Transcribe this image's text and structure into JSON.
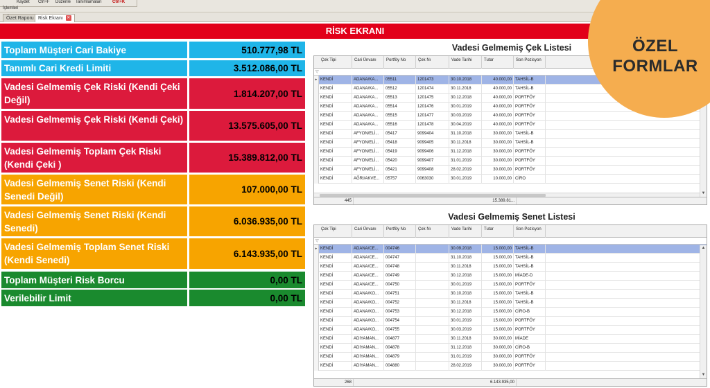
{
  "toolbar": {
    "items": [
      "Kaydet",
      "Ctrl+F",
      "Düzenle",
      "Tanımlamaları",
      "Ctrl+K"
    ],
    "group_label": "İşlemleri"
  },
  "tabs": [
    {
      "label": "Özet Raporu"
    },
    {
      "label": "Risk Ekranı"
    }
  ],
  "title": "RİSK EKRANI",
  "risk_items": [
    {
      "label": "Toplam Müşteri Cari Bakiye",
      "value": "510.777,98 TL",
      "color": "#1fb5e8"
    },
    {
      "label": "Tanımlı Cari Kredi Limiti",
      "value": "3.512.086,00 TL",
      "color": "#1fb5e8"
    },
    {
      "label": "Vadesi Gelmemiş Çek Riski (Kendi Çeki Değil)",
      "value": "1.814.207,00 TL",
      "color": "#dc1a3c"
    },
    {
      "label": "Vadesi Gelmemiş Çek Riski (Kendi Çeki)",
      "value": "13.575.605,00 TL",
      "color": "#dc1a3c"
    },
    {
      "label": "Vadesi Gelmemiş Toplam Çek Riski (Kendi Çeki )",
      "value": "15.389.812,00 TL",
      "color": "#dc1a3c"
    },
    {
      "label": "Vadesi Gelmemiş Senet Riski (Kendi Senedi Değil)",
      "value": "107.000,00 TL",
      "color": "#f7a400"
    },
    {
      "label": "Vadesi Gelmemiş Senet Riski (Kendi Senedi)",
      "value": "6.036.935,00 TL",
      "color": "#f7a400"
    },
    {
      "label": "Vadesi Gelmemiş Toplam Senet Riski (Kendi Senedi)",
      "value": "6.143.935,00 TL",
      "color": "#f7a400"
    },
    {
      "label": "Toplam Müşteri Risk Borcu",
      "value": "0,00 TL",
      "color": "#1a8a2e"
    },
    {
      "label": "Verilebilir Limit",
      "value": "0,00 TL",
      "color": "#1a8a2e"
    }
  ],
  "cek_grid": {
    "title": "Vadesi Gelmemiş Çek Listesi",
    "columns": [
      "Çek Tipi",
      "Cari Ünvanı",
      "Portföy No",
      "Çek Nı",
      "Vade Tarihi",
      "Tutar",
      "Son Pozisyon"
    ],
    "rows": [
      [
        "KENDİ",
        "ADANA/KA...",
        "05511",
        "1201473",
        "30.10.2018",
        "40.000,00",
        "TAHSİL-B"
      ],
      [
        "KENDİ",
        "ADANA/KA...",
        "05512",
        "1201474",
        "30.11.2018",
        "40.000,00",
        "TAHSİL-B"
      ],
      [
        "KENDİ",
        "ADANA/KA...",
        "05513",
        "1201475",
        "30.12.2018",
        "40.000,00",
        "PORTFÖY"
      ],
      [
        "KENDİ",
        "ADANA/KA...",
        "05514",
        "1201476",
        "30.01.2019",
        "40.000,00",
        "PORTFÖY"
      ],
      [
        "KENDİ",
        "ADANA/KA...",
        "05515",
        "1201477",
        "30.03.2019",
        "40.000,00",
        "PORTFÖY"
      ],
      [
        "KENDİ",
        "ADANA/KA...",
        "05516",
        "1201478",
        "30.04.2019",
        "40.000,00",
        "PORTFÖY"
      ],
      [
        "KENDİ",
        "AFYON/ELİ...",
        "05417",
        "9099404",
        "31.10.2018",
        "30.000,00",
        "TAHSİL-B"
      ],
      [
        "KENDİ",
        "AFYON/ELİ...",
        "05418",
        "9099405",
        "30.11.2018",
        "30.000,00",
        "TAHSİL-B"
      ],
      [
        "KENDİ",
        "AFYON/ELİ...",
        "05419",
        "9099406",
        "31.12.2018",
        "30.000,00",
        "PORTFÖY"
      ],
      [
        "KENDİ",
        "AFYON/ELİ...",
        "05420",
        "9099407",
        "31.01.2019",
        "30.000,00",
        "PORTFÖY"
      ],
      [
        "KENDİ",
        "AFYON/ELİ...",
        "05421",
        "9099408",
        "28.02.2019",
        "30.000,00",
        "PORTFÖY"
      ],
      [
        "KENDİ",
        "AĞRI/AKVE...",
        "05757",
        "0063030",
        "30.01.2019",
        "10.000,00",
        "CİRO"
      ]
    ],
    "footer_count": "445",
    "footer_total": "15.389.81..."
  },
  "senet_grid": {
    "title": "Vadesi Gelmemiş Senet Listesi",
    "columns": [
      "Çek Tipi",
      "Cari Ünvanı",
      "Portföy No",
      "Çek Nı",
      "Vade Tarihi",
      "Tutar",
      "Son Pozisyon"
    ],
    "rows": [
      [
        "KENDİ",
        "ADANA/CE...",
        "004746",
        "",
        "30.09.2018",
        "15.000,00",
        "TAHSİL-B"
      ],
      [
        "KENDİ",
        "ADANA/CE...",
        "004747",
        "",
        "31.10.2018",
        "15.000,00",
        "TAHSİL-B"
      ],
      [
        "KENDİ",
        "ADANA/CE...",
        "004748",
        "",
        "30.11.2018",
        "15.000,00",
        "TAHSİL-B"
      ],
      [
        "KENDİ",
        "ADANA/CE...",
        "004749",
        "",
        "30.12.2018",
        "15.000,00",
        "MİADE-D"
      ],
      [
        "KENDİ",
        "ADANA/CE...",
        "004750",
        "",
        "30.01.2019",
        "15.000,00",
        "PORTFÖY"
      ],
      [
        "KENDİ",
        "ADANA/KO...",
        "004751",
        "",
        "30.10.2018",
        "15.000,00",
        "TAHSİL-B"
      ],
      [
        "KENDİ",
        "ADANA/KO...",
        "004752",
        "",
        "30.11.2018",
        "15.000,00",
        "TAHSİL-B"
      ],
      [
        "KENDİ",
        "ADANA/KO...",
        "004753",
        "",
        "30.12.2018",
        "15.000,00",
        "CİRO-B"
      ],
      [
        "KENDİ",
        "ADANA/KO...",
        "004754",
        "",
        "30.01.2019",
        "15.000,00",
        "PORTFÖY"
      ],
      [
        "KENDİ",
        "ADANA/KO...",
        "004755",
        "",
        "30.03.2019",
        "15.000,00",
        "PORTFÖY"
      ],
      [
        "KENDİ",
        "ADIYAMAN...",
        "004877",
        "",
        "30.11.2018",
        "30.000,00",
        "MİADE"
      ],
      [
        "KENDİ",
        "ADIYAMAN...",
        "004878",
        "",
        "31.12.2018",
        "30.000,00",
        "CİRO-B"
      ],
      [
        "KENDİ",
        "ADIYAMAN...",
        "004879",
        "",
        "31.01.2019",
        "30.000,00",
        "PORTFÖY"
      ],
      [
        "KENDİ",
        "ADIYAMAN...",
        "004880",
        "",
        "28.02.2019",
        "30.000,00",
        "PORTFÖY"
      ]
    ],
    "footer_count": "268",
    "footer_total": "6.143.935,00"
  },
  "badge": {
    "line1": "ÖZEL",
    "line2": "FORMLAR"
  },
  "colors": {
    "title_red": "#e2001a",
    "cyan": "#1fb5e8",
    "red": "#dc1a3c",
    "orange": "#f7a400",
    "green": "#1a8a2e",
    "selection": "#9fb4e6",
    "badge": "#f5ad4f"
  }
}
